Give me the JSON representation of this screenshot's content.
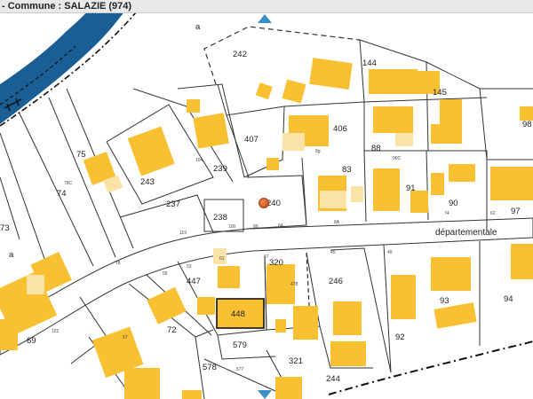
{
  "header": {
    "title": "- Commune : SALAZIE (974)"
  },
  "road_label": "départementale",
  "corner_label_top": "a",
  "corner_label_left": "a",
  "colors": {
    "building": "#f9c132",
    "building_light": "#fbe3a8",
    "river": "#1a5e96",
    "parcel_line": "#333333",
    "marker": "#3a8fc4",
    "location_dot": "#d9561f"
  },
  "icons": {
    "marker": "triangle-marker-icon",
    "location": "location-dot-icon"
  },
  "parcels": {
    "p242": "242",
    "p144": "144",
    "p145": "145",
    "p98": "98",
    "p75": "75",
    "p74": "74",
    "p243": "243",
    "p407": "407",
    "p406": "406",
    "p88": "88",
    "p83": "83",
    "p91": "91",
    "p90": "90",
    "p97": "97",
    "p239": "239",
    "p237": "237",
    "p238": "238",
    "p240": "240",
    "p73": "73",
    "p447": "447",
    "p320": "320",
    "p246": "246",
    "p93": "93",
    "p94": "94",
    "p448": "448",
    "p72": "72",
    "p579": "579",
    "p92": "92",
    "p69": "69",
    "p578": "578",
    "p321": "321",
    "p244": "244"
  },
  "small_numbers": {
    "s78c": "78C",
    "s104": "104",
    "s8g": "8g",
    "s90c": "90C",
    "s74": "74",
    "s62": "62",
    "s119": "119",
    "s100": "100",
    "s89": "89",
    "s64": "64",
    "s8a": "8A",
    "s61": "61",
    "s47": "47",
    "s478": "478",
    "s45": "45",
    "s49": "49",
    "s55": "55",
    "s53": "53",
    "s57": "57",
    "s577": "577",
    "s122": "122",
    "s78": "78"
  }
}
